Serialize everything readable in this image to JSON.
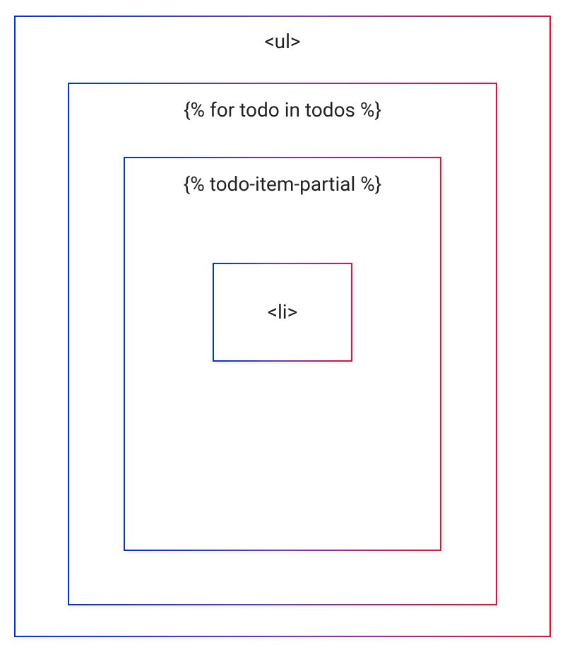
{
  "diagram": {
    "outer": {
      "label": "<ul>"
    },
    "middle": {
      "label": "{% for todo in todos %}"
    },
    "inner": {
      "label": "{% todo-item-partial %}"
    },
    "innermost": {
      "label": "<li>"
    }
  }
}
